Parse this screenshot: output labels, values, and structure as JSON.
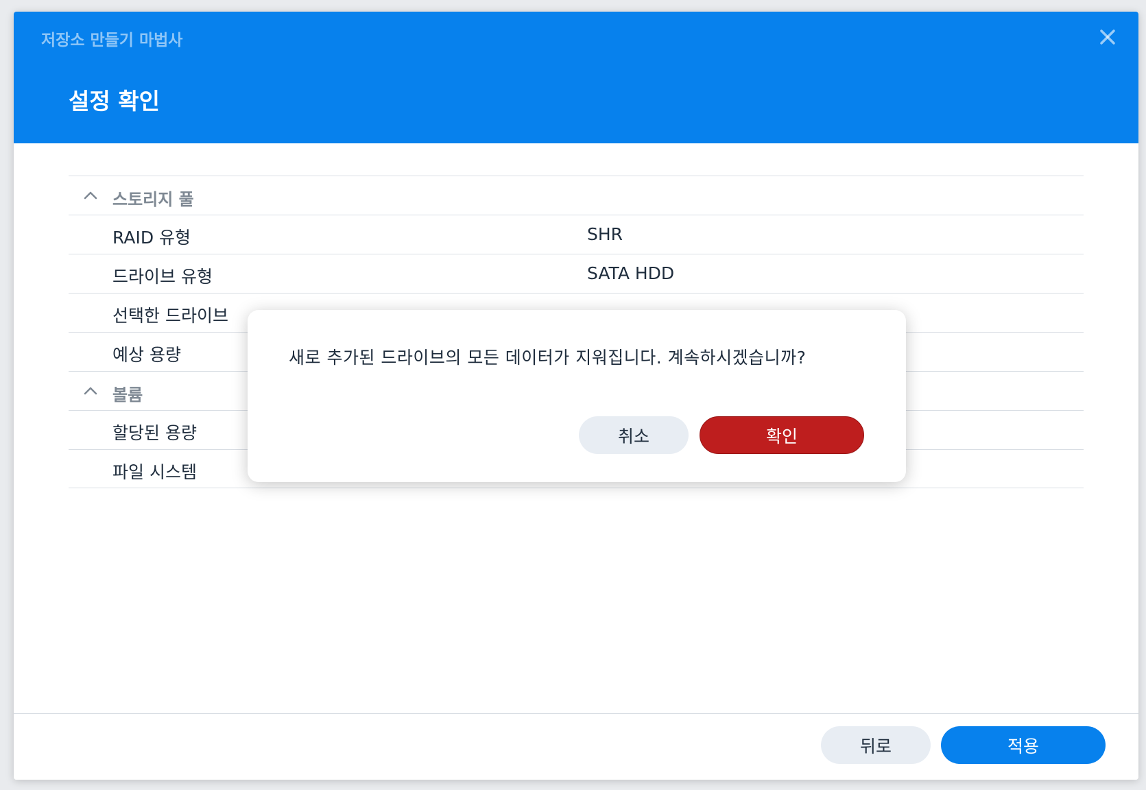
{
  "window": {
    "wizard_title": "저장소 만들기 마법사",
    "step_title": "설정 확인",
    "close_icon": "close-icon"
  },
  "summary": {
    "sections": [
      {
        "label": "스토리지 풀",
        "rows": [
          {
            "key": "RAID 유형",
            "value": "SHR"
          },
          {
            "key": "드라이브 유형",
            "value": "SATA HDD"
          },
          {
            "key": "선택한 드라이브",
            "value": ""
          },
          {
            "key": "예상 용량",
            "value": ""
          }
        ]
      },
      {
        "label": "볼륨",
        "rows": [
          {
            "key": "할당된 용량",
            "value": ""
          },
          {
            "key": "파일 시스템",
            "value": ""
          }
        ]
      }
    ]
  },
  "footer": {
    "back_label": "뒤로",
    "apply_label": "적용"
  },
  "modal": {
    "message": "새로 추가된 드라이브의 모든 데이터가 지워집니다. 계속하시겠습니까?",
    "cancel_label": "취소",
    "confirm_label": "확인"
  },
  "colors": {
    "header_blue": "#0781ed",
    "confirm_red": "#be1e1e",
    "secondary_button": "#e8edf3"
  }
}
